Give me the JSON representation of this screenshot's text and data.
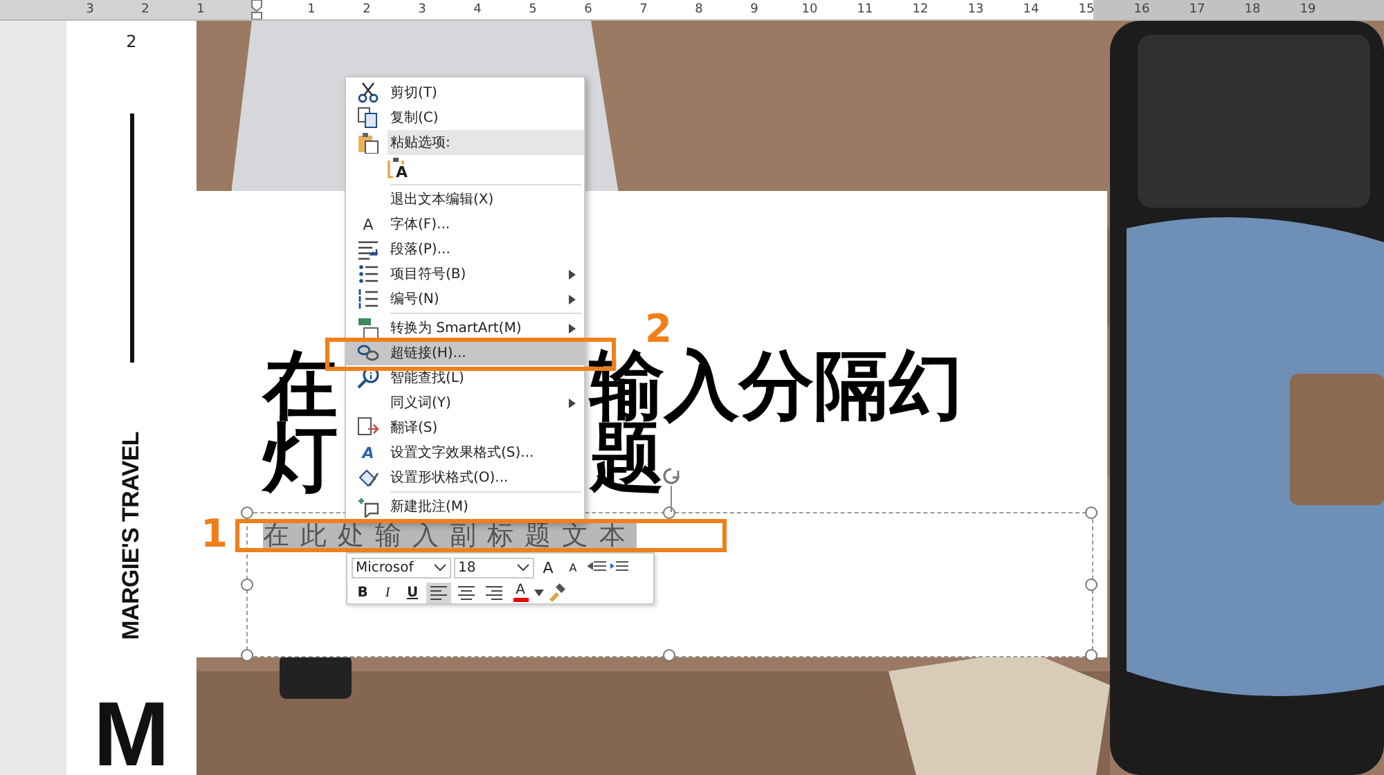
{
  "ruler": {
    "labels": [
      "3",
      "2",
      "1",
      "1",
      "2",
      "3",
      "4",
      "5",
      "6",
      "7",
      "8",
      "9",
      "10",
      "11",
      "12",
      "13",
      "14",
      "15",
      "16",
      "17",
      "18",
      "19"
    ]
  },
  "slide": {
    "page_number": "2",
    "brand": "MARGIE'S TRAVEL",
    "brand_initial": "M",
    "title_lines": [
      [
        "在",
        "输入分隔幻"
      ],
      [
        "灯",
        "题"
      ]
    ],
    "subtitle": "在此处输入副标题文本",
    "subtitle_selected": true
  },
  "context_menu": {
    "items": [
      {
        "kind": "command",
        "label": "剪切(T)",
        "submenu": false,
        "selected": false
      },
      {
        "kind": "command",
        "label": "复制(C)",
        "submenu": false,
        "selected": false
      },
      {
        "kind": "header",
        "label": "粘贴选项:"
      },
      {
        "kind": "paste",
        "icon_text": "A"
      },
      {
        "kind": "separator"
      },
      {
        "kind": "command",
        "label": "退出文本编辑(X)",
        "submenu": false,
        "selected": false
      },
      {
        "kind": "command",
        "label": "字体(F)...",
        "icon_text": "A",
        "submenu": false,
        "selected": false
      },
      {
        "kind": "command",
        "label": "段落(P)...",
        "submenu": false,
        "selected": false
      },
      {
        "kind": "command",
        "label": "项目符号(B)",
        "submenu": true,
        "selected": false
      },
      {
        "kind": "command",
        "label": "编号(N)",
        "submenu": true,
        "selected": false
      },
      {
        "kind": "separator"
      },
      {
        "kind": "command",
        "label": "转换为 SmartArt(M)",
        "submenu": true,
        "selected": false
      },
      {
        "kind": "command",
        "label": "超链接(H)...",
        "submenu": false,
        "selected": true
      },
      {
        "kind": "command",
        "label": "智能查找(L)",
        "submenu": false,
        "selected": false
      },
      {
        "kind": "command",
        "label": "同义词(Y)",
        "submenu": true,
        "selected": false
      },
      {
        "kind": "command",
        "label": "翻译(S)",
        "submenu": false,
        "selected": false
      },
      {
        "kind": "command",
        "label": "设置文字效果格式(S)...",
        "icon_text": "A",
        "submenu": false,
        "selected": false
      },
      {
        "kind": "command",
        "label": "设置形状格式(O)...",
        "submenu": false,
        "selected": false
      },
      {
        "kind": "separator"
      },
      {
        "kind": "command",
        "label": "新建批注(M)",
        "submenu": false,
        "selected": false
      }
    ]
  },
  "mini_toolbar": {
    "font": "Microsof",
    "size": "18",
    "grow_font": "A",
    "shrink_font": "A",
    "bold": "B",
    "italic": "I",
    "underline": "U",
    "align": [
      {
        "selected": true
      },
      {
        "selected": false
      },
      {
        "selected": false
      }
    ],
    "font_color": "A"
  },
  "annotations": [
    {
      "label": "1"
    },
    {
      "label": "2"
    }
  ]
}
